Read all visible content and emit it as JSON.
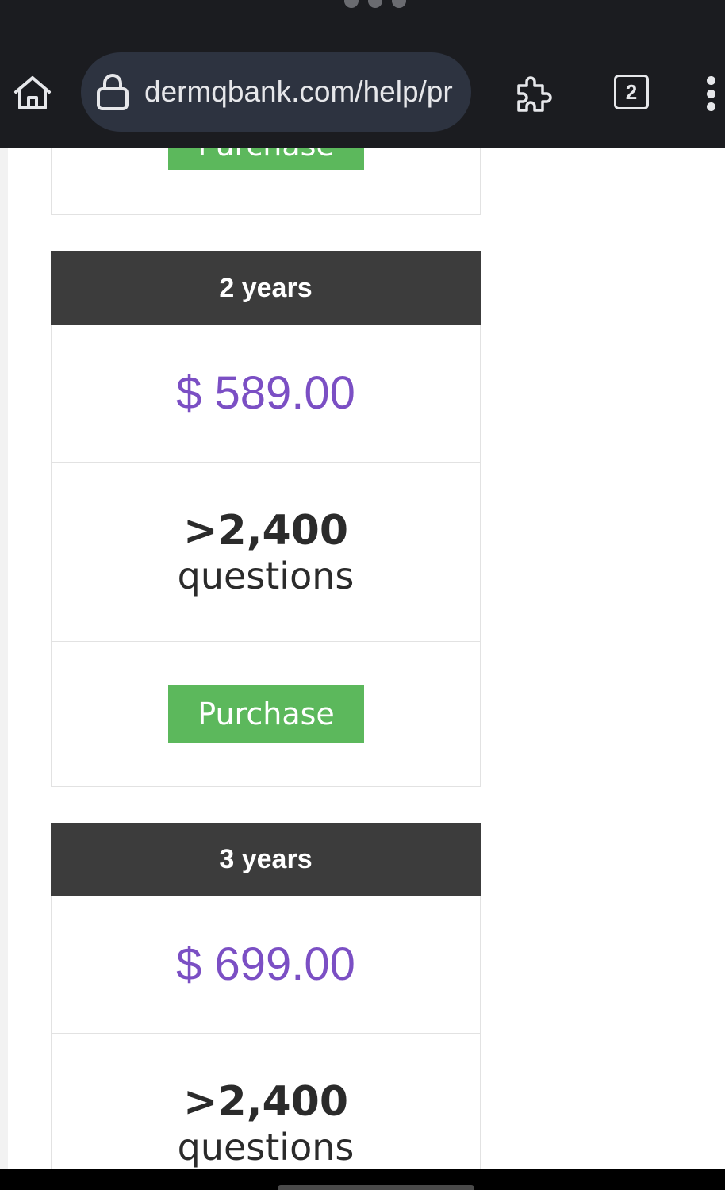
{
  "browser": {
    "url": "dermqbank.com/help/pr",
    "tab_count": "2"
  },
  "previous_plan": {
    "purchase_label": "Purchase"
  },
  "plans": [
    {
      "duration": "2 years",
      "price": "$ 589.00",
      "questions_count": ">2,400",
      "questions_label": "questions",
      "purchase_label": "Purchase"
    },
    {
      "duration": "3 years",
      "price": "$ 699.00",
      "questions_count": ">2,400",
      "questions_label": "questions"
    }
  ],
  "colors": {
    "header_bg": "#3c3c3c",
    "price": "#7b4fc4",
    "purchase_button": "#5cb85c",
    "chrome_bg": "#1b1c20"
  }
}
